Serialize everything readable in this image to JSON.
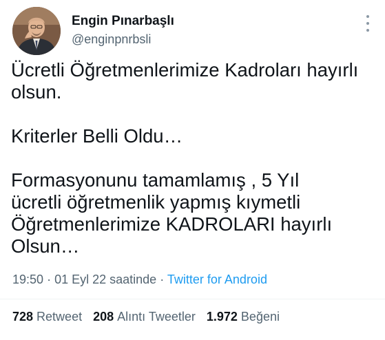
{
  "author": {
    "name": "Engin Pınarbaşlı",
    "handle": "@enginpnrbsli"
  },
  "tweet": {
    "lines": [
      "Ücretli Öğretmenlerimize Kadroları hayırlı",
      "olsun.",
      "",
      "Kriterler Belli Oldu…",
      "",
      "Formasyonunu tamamlamış , 5 Yıl",
      "ücretli öğretmenlik yapmış kıymetli",
      "Öğretmenlerimize KADROLARI hayırlı",
      "Olsun…"
    ]
  },
  "meta": {
    "time": "19:50",
    "separator1": "·",
    "date": "01 Eyl 22 saatinde",
    "separator2": "·",
    "source": "Twitter for Android"
  },
  "stats": {
    "retweets": {
      "count": "728",
      "label": "Retweet"
    },
    "quotes": {
      "count": "208",
      "label": "Alıntı Tweetler"
    },
    "likes": {
      "count": "1.972",
      "label": "Beğeni"
    }
  },
  "colors": {
    "text": "#0f1419",
    "secondary": "#536471",
    "link": "#1d9bf0",
    "divider": "#eff3f4"
  },
  "icons": {
    "more": "more-vertical-icon"
  }
}
